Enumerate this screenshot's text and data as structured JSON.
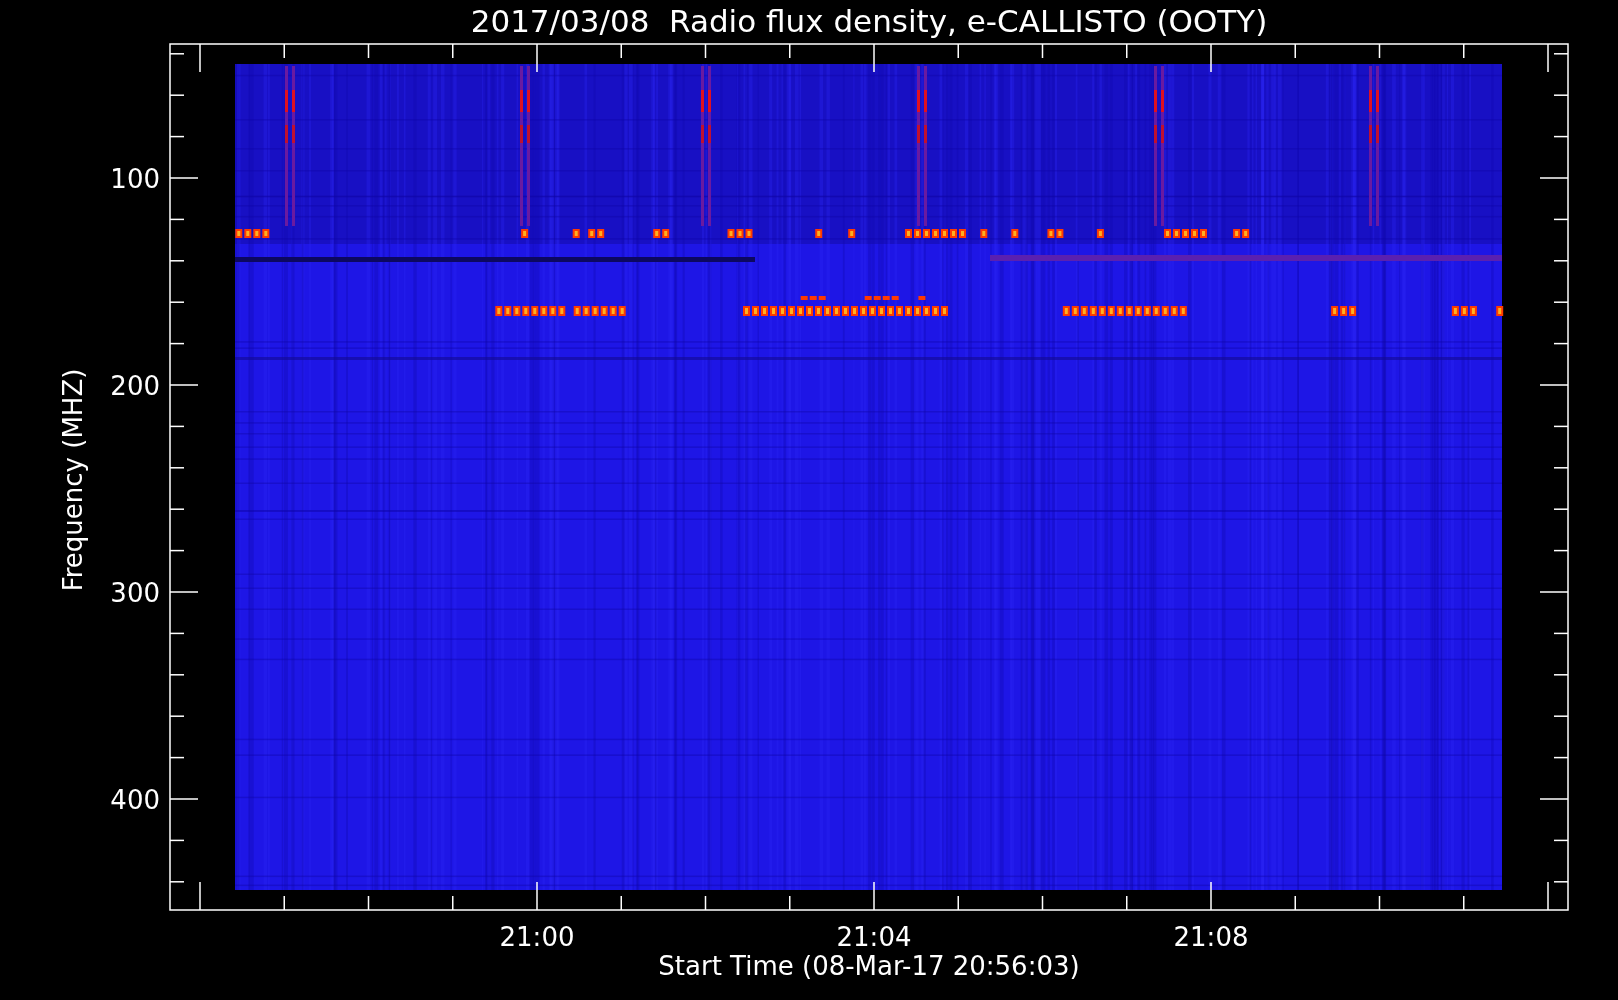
{
  "title": "2017/03/08  Radio flux density, e-CALLISTO (OOTY)",
  "y_axis": {
    "label": "Frequency (MHZ)",
    "ticks": [
      "100",
      "200",
      "300",
      "400"
    ]
  },
  "x_axis": {
    "label": "Start Time (08-Mar-17 20:56:03)",
    "ticks": [
      "21:00",
      "21:04",
      "21:08"
    ]
  }
}
